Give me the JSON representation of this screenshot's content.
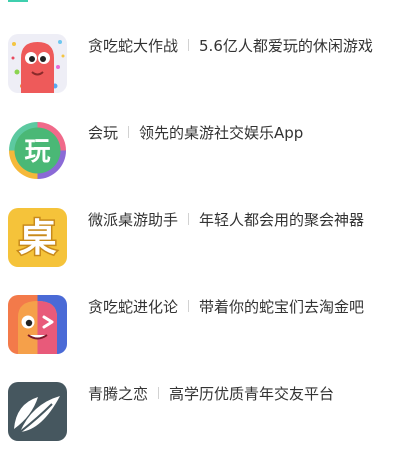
{
  "colors": {
    "accent": "#3fcfae",
    "text": "#333333",
    "separator": "#d2d2d2"
  },
  "apps": [
    {
      "name": "贪吃蛇大作战",
      "tagline": "5.6亿人都爱玩的休闲游戏",
      "icon": "snake-game-icon"
    },
    {
      "name": "会玩",
      "tagline": "领先的桌游社交娱乐App",
      "icon": "huiwan-icon",
      "icon_glyph": "玩"
    },
    {
      "name": "微派桌游助手",
      "tagline": "年轻人都会用的聚会神器",
      "icon": "table-game-icon",
      "icon_glyph": "桌"
    },
    {
      "name": "贪吃蛇进化论",
      "tagline": "带着你的蛇宝们去淘金吧",
      "icon": "snake-evolution-icon"
    },
    {
      "name": "青腾之恋",
      "tagline": "高学历优质青年交友平台",
      "icon": "leaf-icon"
    }
  ]
}
